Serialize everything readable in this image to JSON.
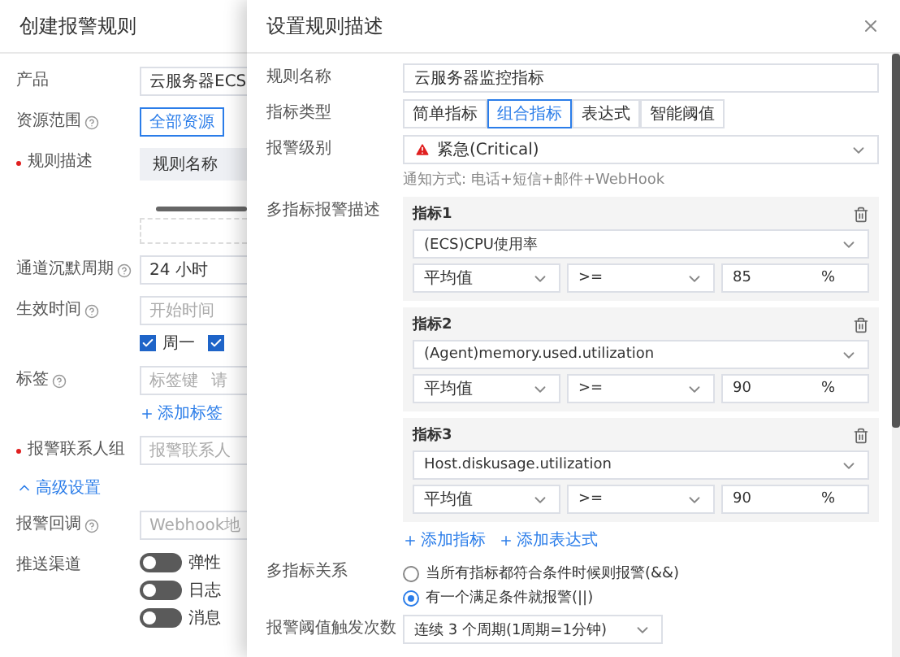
{
  "background_panel": {
    "title": "创建报警规则",
    "rows": [
      {
        "kind": "input",
        "label": "产品",
        "value": "云服务器ECS"
      },
      {
        "kind": "segmented",
        "label": "资源范围",
        "help": true,
        "options": [
          {
            "label": "全部资源",
            "selected": true
          }
        ]
      },
      {
        "kind": "table",
        "label": "规则描述",
        "required": true,
        "header": "规则名称"
      },
      {
        "kind": "input",
        "label": "通道沉默周期",
        "help": true,
        "value": "24 小时"
      },
      {
        "kind": "time",
        "label": "生效时间",
        "help": true,
        "placeholder": "开始时间",
        "checkboxes": [
          {
            "label": "周一",
            "checked": true
          },
          {
            "checked": true
          }
        ]
      },
      {
        "kind": "tags",
        "label": "标签",
        "help": true,
        "placeholder": "标签键",
        "value_placeholder": "请",
        "link": "添加标签"
      },
      {
        "kind": "input",
        "label": "报警联系人组",
        "required": true,
        "placeholder": "报警联系人"
      },
      {
        "kind": "expander",
        "label": "高级设置",
        "expanded": true
      },
      {
        "kind": "input",
        "label": "报警回调",
        "help": true,
        "placeholder": "Webhook地"
      },
      {
        "kind": "toggles",
        "label": "推送渠道",
        "toggles": [
          {
            "label": "弹性",
            "on": false
          },
          {
            "label": "日志",
            "on": false
          },
          {
            "label": "消息",
            "on": false
          }
        ]
      }
    ]
  },
  "drawer": {
    "title": "设置规则描述",
    "rule_name": {
      "label": "规则名称",
      "value": "云服务器监控指标"
    },
    "metric_type": {
      "label": "指标类型",
      "options": [
        {
          "label": "简单指标",
          "selected": false
        },
        {
          "label": "组合指标",
          "selected": true
        },
        {
          "label": "表达式",
          "selected": false
        },
        {
          "label": "智能阈值",
          "selected": false
        }
      ]
    },
    "alarm_level": {
      "label": "报警级别",
      "value": "紧急(Critical)",
      "note": "通知方式: 电话+短信+邮件+WebHook"
    },
    "metrics": {
      "label": "多指标报警描述",
      "items": [
        {
          "title": "指标1",
          "metric": "(ECS)CPU使用率",
          "statistic": "平均值",
          "operator": ">=",
          "threshold": "85",
          "unit": "%"
        },
        {
          "title": "指标2",
          "metric": "(Agent)memory.used.utilization",
          "statistic": "平均值",
          "operator": ">=",
          "threshold": "90",
          "unit": "%"
        },
        {
          "title": "指标3",
          "metric": "Host.diskusage.utilization",
          "statistic": "平均值",
          "operator": ">=",
          "threshold": "90",
          "unit": "%"
        }
      ],
      "links": [
        "添加指标",
        "添加表达式"
      ]
    },
    "relation": {
      "label": "多指标关系",
      "options": [
        {
          "label": "当所有指标都符合条件时候则报警(&&)",
          "selected": false
        },
        {
          "label": "有一个满足条件就报警(||)",
          "selected": true
        }
      ]
    },
    "trigger": {
      "label": "报警阈值触发次数",
      "value": "连续 3 个周期(1周期=1分钟)"
    }
  }
}
